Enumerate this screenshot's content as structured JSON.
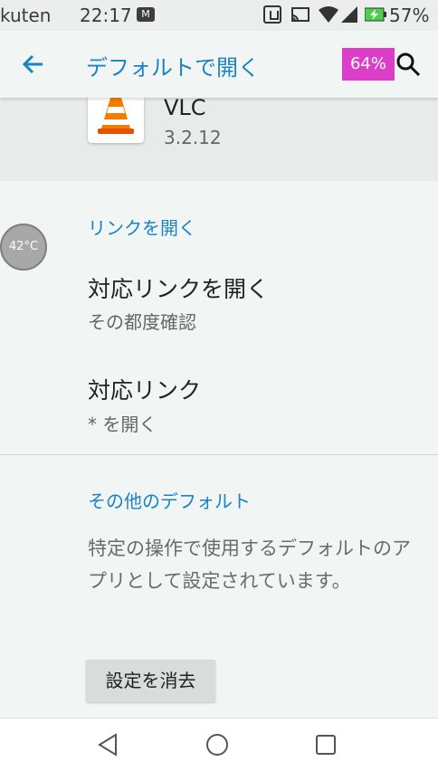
{
  "status_bar": {
    "carrier": "kuten",
    "time": "22:17",
    "notification_icon": "M",
    "battery": "57%"
  },
  "app_bar": {
    "title": "デフォルトで開く",
    "memory_badge": "64%",
    "back_icon": "arrow-left",
    "search_icon": "magnifier"
  },
  "app": {
    "name": "VLC",
    "version": "3.2.12"
  },
  "temperature_bubble": "42°C",
  "links_section": {
    "header": "リンクを開く",
    "items": [
      {
        "title": "対応リンクを開く",
        "summary": "その都度確認"
      },
      {
        "title": "対応リンク",
        "summary": "* を開く"
      }
    ]
  },
  "other_defaults": {
    "header": "その他のデフォルト",
    "description": "特定の操作で使用するデフォルトのアプリとして設定されています。",
    "clear_button": "設定を消去"
  },
  "colors": {
    "accent": "#1b82c3",
    "badge": "#dd3ec9",
    "background": "#f1f6f5"
  }
}
